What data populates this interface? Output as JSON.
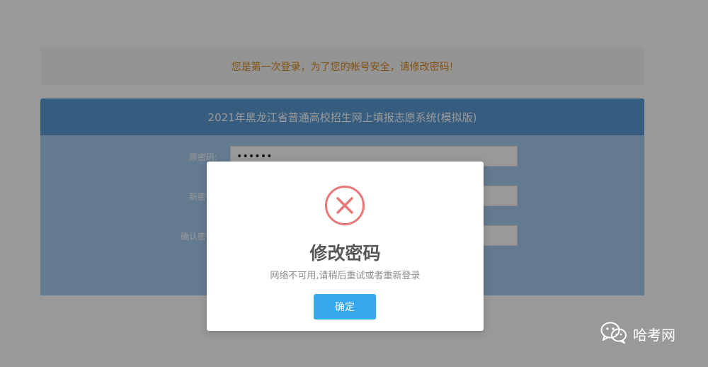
{
  "notice": {
    "text": "您是第一次登录，为了您的帐号安全，请修改密码!"
  },
  "form": {
    "header": "2021年黑龙江省普通高校招生网上填报志愿系统(模拟版)",
    "fields": [
      {
        "label": "原密码:",
        "value": "••••••"
      },
      {
        "label": "新密码:",
        "value": ""
      },
      {
        "label": "确认密码:",
        "value": ""
      }
    ]
  },
  "dialog": {
    "icon": "error-circle-x-icon",
    "title": "修改密码",
    "message": "网络不可用,请稍后重试或者重新登录",
    "confirm_label": "确定"
  },
  "watermark": {
    "icon": "wechat-icon",
    "text": "哈考网"
  },
  "colors": {
    "notice_text": "#d9891f",
    "header_bg": "#5b9cd6",
    "panel_bg": "#a7cbef",
    "error_red": "#e87777",
    "button_blue": "#36a9ec"
  }
}
